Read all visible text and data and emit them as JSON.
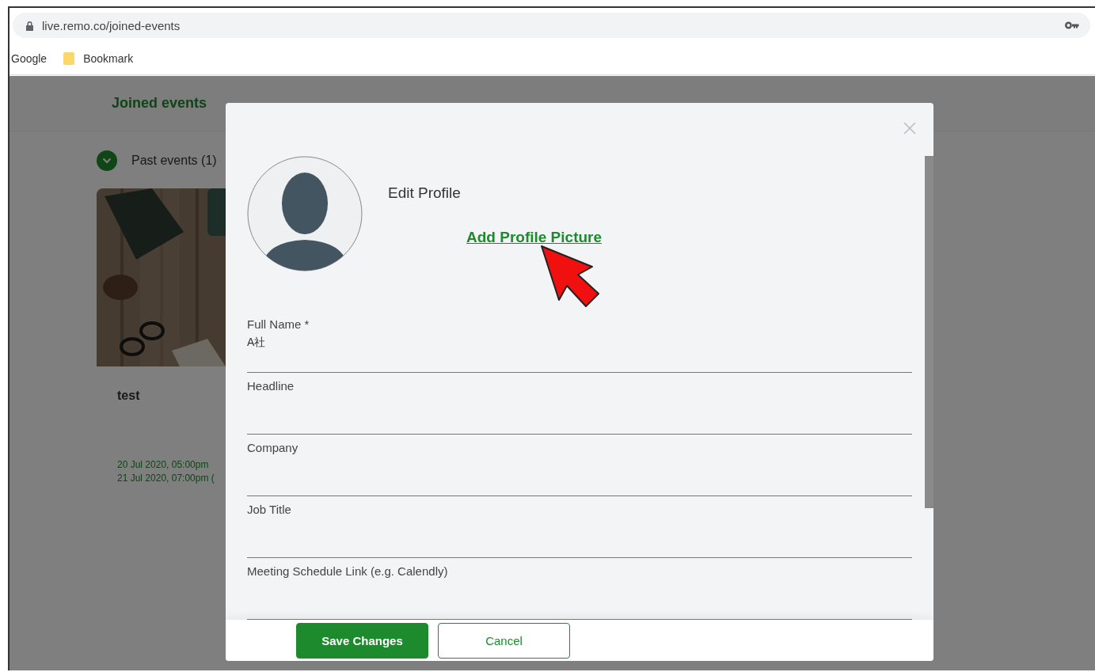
{
  "browser": {
    "url": "live.remo.co/joined-events",
    "bookmarks": [
      {
        "label": "Google",
        "kind": "text"
      },
      {
        "label": "Bookmark",
        "kind": "folder"
      }
    ]
  },
  "page": {
    "title": "Joined events",
    "section": {
      "label": "Past events (1)",
      "expanded": true
    },
    "event_card": {
      "name": "test",
      "start": "20 Jul 2020, 05:00pm",
      "end": "21 Jul 2020, 07:00pm ("
    }
  },
  "modal": {
    "title": "Edit Profile",
    "link": "Add Profile Picture",
    "fields": [
      {
        "label": "Full Name *",
        "value": "A社"
      },
      {
        "label": "Headline"
      },
      {
        "label": "Company"
      },
      {
        "label": "Job Title"
      },
      {
        "label": "Meeting Schedule Link (e.g. Calendly)"
      }
    ],
    "buttons": [
      {
        "label": "Save Changes",
        "kind": "primary"
      },
      {
        "label": "Cancel",
        "kind": "secondary"
      }
    ]
  }
}
